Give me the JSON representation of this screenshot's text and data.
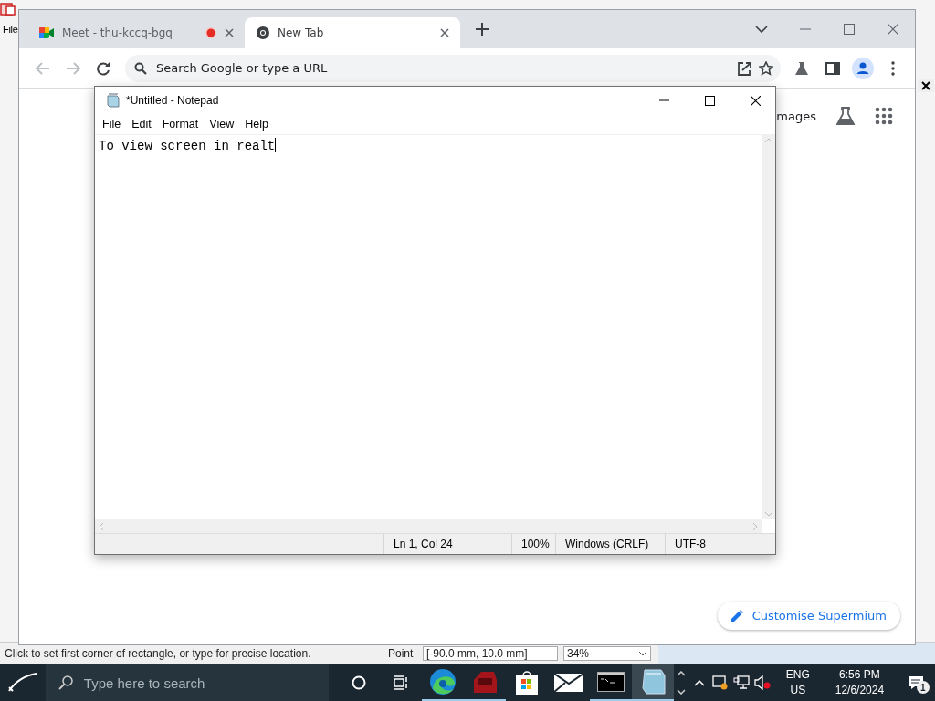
{
  "background_app": {
    "menu": "File",
    "status_text": "Click to set first corner of rectangle, or type for precise location.",
    "point_label": "Point",
    "point_value": "[-90.0 mm, 10.0 mm]",
    "zoom": "34%"
  },
  "browser": {
    "tabs": [
      {
        "title": "Meet - thu-kccq-bgq",
        "recording": true,
        "selected": false
      },
      {
        "title": "New Tab",
        "recording": false,
        "selected": true
      }
    ],
    "omnibox": {
      "placeholder": "Search Google or type a URL"
    },
    "images_link": "mages",
    "customise_button": "Customise Supermium"
  },
  "notepad": {
    "title": "*Untitled - Notepad",
    "menu": [
      "File",
      "Edit",
      "Format",
      "View",
      "Help"
    ],
    "text": "To view screen in realt",
    "status": [
      "Ln 1, Col 24",
      "100%",
      "Windows (CRLF)",
      "UTF-8"
    ]
  },
  "taskbar": {
    "search_placeholder": "Type here to search",
    "language": "ENG",
    "region": "US",
    "time": "6:56 PM",
    "date": "12/6/2024",
    "notification_count": "1"
  }
}
